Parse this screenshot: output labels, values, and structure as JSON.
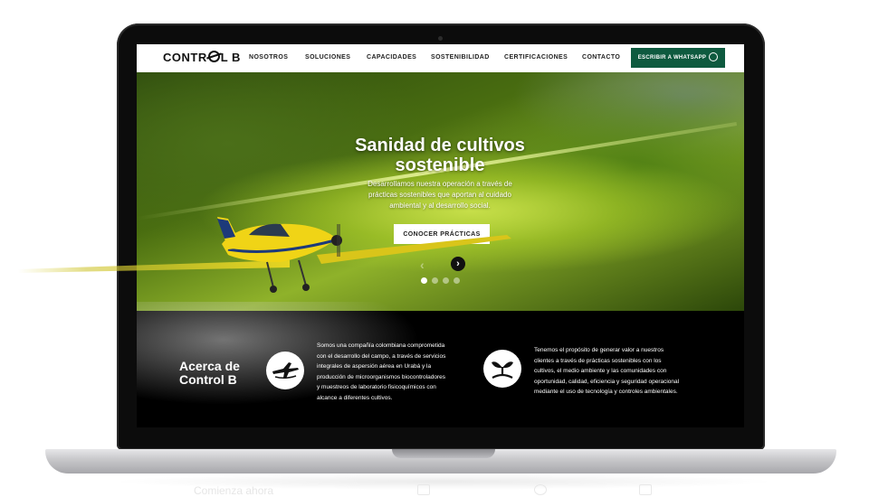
{
  "brand": {
    "logo_part1": "CONTR",
    "logo_part2": "L B"
  },
  "nav": {
    "items": [
      {
        "label": "NOSOTROS"
      },
      {
        "label": "SOLUCIONES"
      },
      {
        "label": "CAPACIDADES"
      },
      {
        "label": "SOSTENIBILIDAD"
      },
      {
        "label": "CERTIFICACIONES"
      },
      {
        "label": "CONTACTO"
      }
    ],
    "whatsapp_label": "ESCRIBIR A WHATSAPP"
  },
  "hero": {
    "title_line1": "Sanidad de cultivos",
    "title_line2": "sostenible",
    "subtitle_line1": "Desarrollamos nuestra operación a través de",
    "subtitle_line2": "prácticas sostenibles que aportan al cuidado",
    "subtitle_line3": "ambiental y al desarrollo social.",
    "cta_label": "CONOCER PRÁCTICAS",
    "prev_arrow": "‹",
    "next_arrow": "›",
    "slides_count": 4,
    "active_slide": 1
  },
  "about": {
    "title_line1": "Acerca de",
    "title_line2": "Control B",
    "text1_lines": [
      "Somos una compañía colombiana comprometida",
      "con el desarrollo del campo, a través de servicios",
      "integrales de aspersión aérea en Urabá y la",
      "producción de microorganismos biocontroladores",
      "y muestreos de laboratorio fisicoquímicos con",
      "alcance a diferentes cultivos."
    ],
    "text2_lines": [
      "Tenemos el propósito de generar valor a nuestros",
      "clientes a través de prácticas sostenibles con los",
      "cultivos, el medio ambiente y las comunidades con",
      "oportunidad, calidad, eficiencia y seguridad operacional",
      "mediante el uso de tecnología y controles ambientales."
    ],
    "icons": [
      "airplane-icon",
      "seedling-icon"
    ]
  },
  "footer_hint": {
    "text": "Comienza ahora"
  },
  "colors": {
    "accent": "#0e5a3f",
    "hero_green": "#8fb22a",
    "about_bg": "#000000"
  }
}
